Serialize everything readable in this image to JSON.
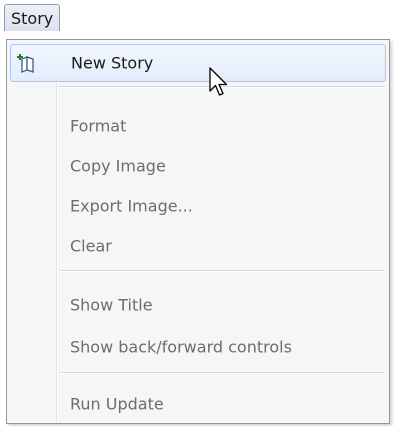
{
  "menubar": {
    "story_label": "Story"
  },
  "menu": {
    "items": [
      {
        "label": "New Story",
        "enabled": true,
        "icon": "new-story-icon"
      },
      {
        "label": "Format",
        "enabled": false
      },
      {
        "label": "Copy Image",
        "enabled": false
      },
      {
        "label": "Export Image...",
        "enabled": false
      },
      {
        "label": "Clear",
        "enabled": false
      },
      {
        "label": "Show Title",
        "enabled": false
      },
      {
        "label": "Show back/forward controls",
        "enabled": false
      },
      {
        "label": "Run Update",
        "enabled": false
      }
    ]
  },
  "colors": {
    "highlight_border": "#a8c8f0",
    "disabled_text": "#6d6d6d",
    "menu_background": "#f5f6f7"
  }
}
